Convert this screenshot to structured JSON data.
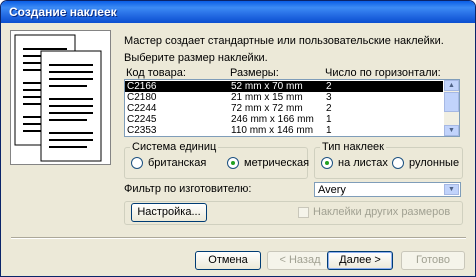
{
  "window": {
    "title": "Создание наклеек"
  },
  "intro": {
    "line1": "Мастер создает стандартные или пользовательские наклейки.",
    "line2": "Выберите размер наклейки."
  },
  "table": {
    "headers": [
      "Код товара:",
      "Размеры:",
      "Число по горизонтали:"
    ],
    "rows": [
      {
        "code": "C2166",
        "size": "52 mm x 70 mm",
        "count": "2"
      },
      {
        "code": "C2180",
        "size": "21 mm x 15 mm",
        "count": "3"
      },
      {
        "code": "C2244",
        "size": "72 mm x 72 mm",
        "count": "2"
      },
      {
        "code": "C2245",
        "size": "246 mm x 166 mm",
        "count": "1"
      },
      {
        "code": "C2353",
        "size": "110 mm x 146 mm",
        "count": "1"
      }
    ]
  },
  "units": {
    "title": "Система единиц",
    "opt1": "британская",
    "opt2": "метрическая",
    "selected": "метрическая"
  },
  "type": {
    "title": "Тип наклеек",
    "opt1": "на листах",
    "opt2": "рулонные",
    "selected": "на листах"
  },
  "filter": {
    "label": "Фильтр по изготовителю:",
    "value": "Avery"
  },
  "buttons": {
    "settings": "Настройка...",
    "other_sizes": "Наклейки других размеров",
    "cancel": "Отмена",
    "back": "< Назад",
    "next": "Далее >",
    "finish": "Готово"
  },
  "colors": {
    "titlebar": "#0a5ee6",
    "selection": "#000000",
    "dialog": "#ece9d8"
  }
}
